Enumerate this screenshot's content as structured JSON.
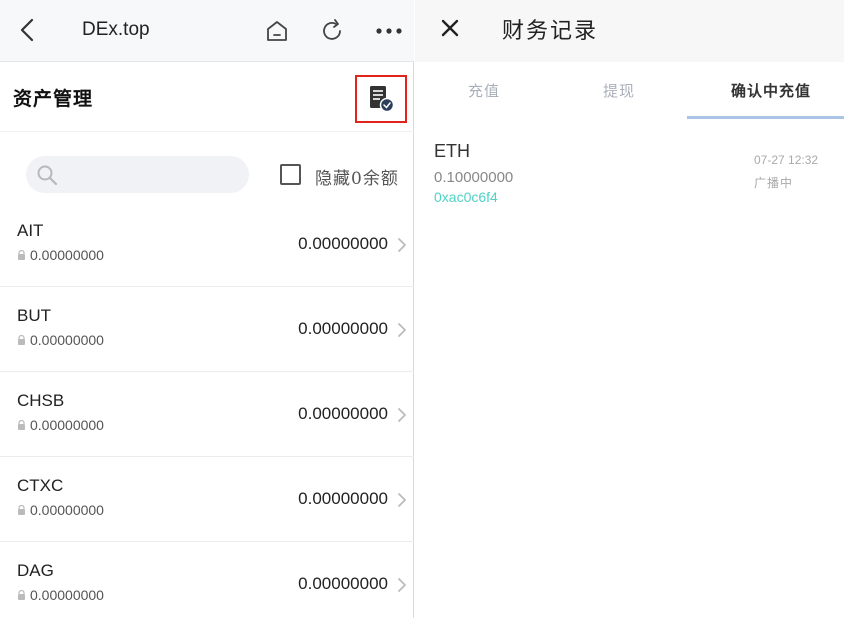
{
  "left_panel": {
    "topbar": {
      "title": "DEx.top",
      "icons": [
        "back-arrow-icon",
        "home-icon",
        "refresh-icon",
        "more-icon"
      ]
    },
    "section_title": "资产管理",
    "records_button_icon": "document-clock-icon",
    "search": {
      "placeholder": "",
      "value": ""
    },
    "hide_zero": {
      "label": "隐藏0余额",
      "checked": false
    },
    "assets": [
      {
        "symbol": "AIT",
        "locked": "0.00000000",
        "balance": "0.00000000"
      },
      {
        "symbol": "BUT",
        "locked": "0.00000000",
        "balance": "0.00000000"
      },
      {
        "symbol": "CHSB",
        "locked": "0.00000000",
        "balance": "0.00000000"
      },
      {
        "symbol": "CTXC",
        "locked": "0.00000000",
        "balance": "0.00000000"
      },
      {
        "symbol": "DAG",
        "locked": "0.00000000",
        "balance": "0.00000000"
      }
    ]
  },
  "right_panel": {
    "title": "财务记录",
    "close_icon": "close-icon",
    "tabs": [
      {
        "label": "充值",
        "active": false
      },
      {
        "label": "提现",
        "active": false
      },
      {
        "label": "确认中充值",
        "active": true
      }
    ],
    "records": [
      {
        "coin": "ETH",
        "amount": "0.10000000",
        "address": "0xac0c6f4",
        "time": "07-27 12:32",
        "status": "广播中"
      }
    ]
  },
  "colors": {
    "highlight_box": "#e2231a",
    "address_text": "#4fd2c4",
    "tab_underline": "#aac3e6",
    "inactive_tab": "#aab0bb"
  }
}
